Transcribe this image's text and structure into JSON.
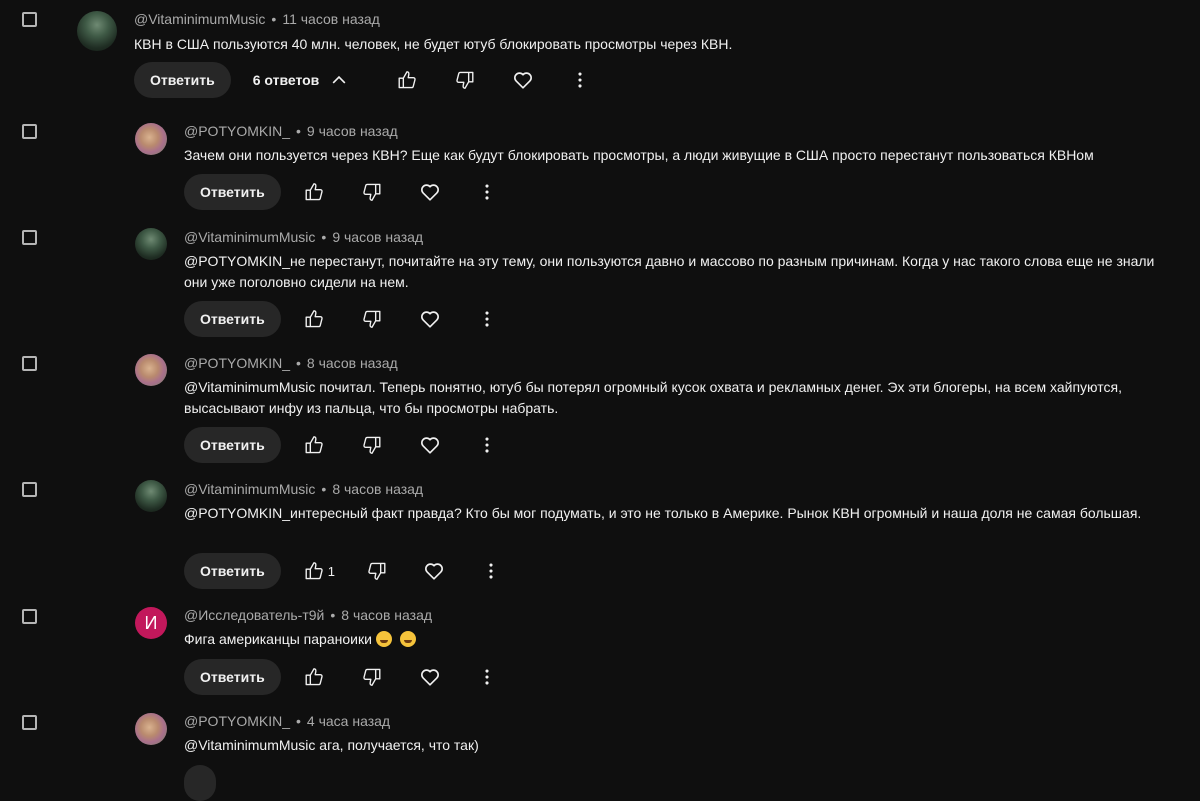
{
  "labels": {
    "reply": "Ответить"
  },
  "top": {
    "author": "@VitaminimumMusic",
    "time": "11 часов назад",
    "text": "КВН в США пользуются 40 млн. человек,  не будет ютуб блокировать просмотры через КВН.",
    "replies_label": "6 ответов"
  },
  "replies": [
    {
      "author": "@POTYOMKIN_",
      "time": "9 часов назад",
      "text": "Зачем они пользуется через КВН?  Еще как будут блокировать просмотры, а люди живущие в США просто перестанут пользоваться КВНом",
      "likes": ""
    },
    {
      "author": "@VitaminimumMusic",
      "time": "9 часов назад",
      "text": "@POTYOMKIN_не перестанут, почитайте на эту тему, они пользуются давно и массово по разным причинам. Когда у нас такого слова еще не знали они уже поголовно  сидели на нем.",
      "likes": ""
    },
    {
      "author": "@POTYOMKIN_",
      "time": "8 часов назад",
      "text": "@VitaminimumMusic  почитал. Теперь понятно, ютуб бы потерял огромный кусок охвата и рекламных денег. Эх эти блогеры, на всем хайпуются, высасывают инфу из пальца, что бы просмотры набрать.",
      "likes": ""
    },
    {
      "author": "@VitaminimumMusic",
      "time": "8 часов назад",
      "text": "@POTYOMKIN_интересный факт правда? Кто бы мог подумать, и это не только в Америке. Рынок КВН огромный и наша доля не самая большая.",
      "likes": "1"
    },
    {
      "author": "@Исследователь-т9й",
      "time": "8 часов назад",
      "text": "Фига американцы параноики",
      "avatar_letter": "И",
      "likes": ""
    },
    {
      "author": "@POTYOMKIN_",
      "time": "4 часа назад",
      "text": "@VitaminimumMusic  ага, получается, что так)",
      "likes": ""
    }
  ],
  "icons": [
    "checkbox",
    "like-icon",
    "dislike-icon",
    "heart-icon",
    "more-vert-icon",
    "chevron-up-icon",
    "laughing-emoji"
  ]
}
